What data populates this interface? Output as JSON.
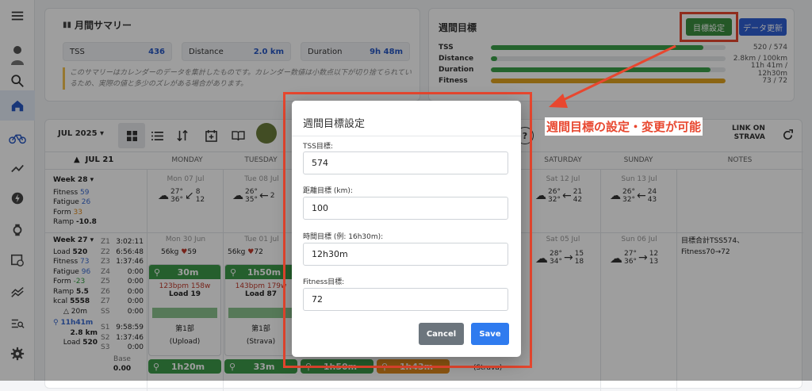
{
  "summary": {
    "title": "月間サマリー",
    "tss_label": "TSS",
    "tss_value": "436",
    "distance_label": "Distance",
    "distance_value": "2.0 km",
    "duration_label": "Duration",
    "duration_value": "9h 48m",
    "note": "このサマリーはカレンダーのデータを集計したものです。カレンダー数値は小数点以下が切り捨てられているため、実際の値と多少のズレがある場合があります。"
  },
  "weekly_goal": {
    "title": "週間目標",
    "set_button": "目標設定",
    "update_button": "データ更新",
    "rows": [
      {
        "label": "TSS",
        "value": "520 / 574",
        "progress": 0.906,
        "color": "#3aa04a"
      },
      {
        "label": "Distance",
        "value": "2.8km / 100km",
        "progress": 0.028,
        "color": "#3aa04a"
      },
      {
        "label": "Duration",
        "value": "11h 41m / 12h30m",
        "progress": 0.935,
        "color": "#3aa04a"
      },
      {
        "label": "Fitness",
        "value": "73 / 72",
        "progress": 1.0,
        "color": "#e0a41f"
      }
    ]
  },
  "toolbar": {
    "month": "JUL 2025 ▾",
    "week_header": "JUL 21",
    "strava_top": "LINK ON",
    "strava_bottom": "STRAVA"
  },
  "columns": [
    "MONDAY",
    "TUESDAY",
    "SATURDAY",
    "SUNDAY",
    "NOTES"
  ],
  "week28": {
    "label": "Week 28",
    "fitness_l": "Fitness",
    "fitness": "59",
    "fatigue_l": "Fatigue",
    "fatigue": "26",
    "form_l": "Form",
    "form": "33",
    "ramp_l": "Ramp",
    "ramp": "-10.8",
    "mon_date": "Mon 07 Jul",
    "mon_t": "27°",
    "mon_t2": "36°",
    "mon_w": "8",
    "mon_w2": "12",
    "tue_date": "Tue 08 Jul",
    "tue_t": "26°",
    "tue_t2": "35°",
    "tue_w": "2",
    "sat_date": "Sat 12 Jul",
    "sat_t": "26°",
    "sat_t2": "32°",
    "sat_w": "21",
    "sat_w2": "42",
    "sun_date": "Sun 13 Jul",
    "sun_t": "26°",
    "sun_t2": "32°",
    "sun_w": "24",
    "sun_w2": "43"
  },
  "week27": {
    "label": "Week 27",
    "load_l": "Load",
    "load": "520",
    "fitness_l": "Fitness",
    "fitness": "73",
    "fatigue_l": "Fatigue",
    "fatigue": "96",
    "form_l": "Form",
    "form": "-23",
    "ramp_l": "Ramp",
    "ramp": "5.5",
    "kcal_l": "kcal",
    "kcal": "5558",
    "elev": "△ 20m",
    "time": "11h41m",
    "dist": "2.8 km",
    "load2_l": "Load",
    "load2": "520",
    "zones": [
      [
        "Z1",
        "3:02:11"
      ],
      [
        "Z2",
        "6:56:48"
      ],
      [
        "Z3",
        "1:37:46"
      ],
      [
        "Z4",
        "0:00"
      ],
      [
        "Z5",
        "0:00"
      ],
      [
        "Z6",
        "0:00"
      ],
      [
        "Z7",
        "0:00"
      ],
      [
        "SS",
        "0:00"
      ]
    ],
    "sweet": [
      [
        "S1",
        "9:58:59"
      ],
      [
        "S2",
        "1:37:46"
      ],
      [
        "S3",
        "0:00"
      ]
    ],
    "base_l": "Base",
    "base": "0.00",
    "mon_date": "Mon 30 Jun",
    "mon_kg": "56kg",
    "mon_hr": "59",
    "tue_date": "Tue 01 Jul",
    "tue_kg": "56kg",
    "tue_hr": "72",
    "sat_date": "Sat 05 Jul",
    "sat_t": "28°",
    "sat_t2": "34°",
    "sat_w": "15",
    "sat_w2": "18",
    "sun_date": "Sun 06 Jul",
    "sun_t": "27°",
    "sun_t2": "36°",
    "sun_w": "12",
    "sun_w2": "13",
    "note1": "目標合計TSS574、",
    "note2": "Fitness70→72",
    "mon_act": {
      "dur": "30m",
      "hr": "123bpm",
      "w": "158w",
      "load": "Load 19",
      "seg": "第1部",
      "src": "(Upload)"
    },
    "tue_act": {
      "dur": "1h50m",
      "hr": "143bpm",
      "w": "179w",
      "load": "Load 87",
      "seg": "第1部",
      "src": "(Strava)"
    },
    "mon_act2": "1h20m",
    "tue_act2": "33m",
    "wed_act2": "1h50m",
    "thu_act2": "1h43m",
    "fri_src": "(Strava)"
  },
  "modal": {
    "title": "週間目標設定",
    "tss_label": "TSS目標:",
    "tss_value": "574",
    "dist_label": "距離目標 (km):",
    "dist_value": "100",
    "time_label": "時間目標 (例: 16h30m):",
    "time_value": "12h30m",
    "fit_label": "Fitness目標:",
    "fit_value": "72",
    "cancel": "Cancel",
    "save": "Save"
  },
  "callout": "週間目標の設定・変更が可能",
  "colors": {
    "accent": "#2857c4",
    "green": "#3aa04a",
    "annot": "#e8472f",
    "save": "#2f7bef",
    "cancel": "#6c757d"
  }
}
